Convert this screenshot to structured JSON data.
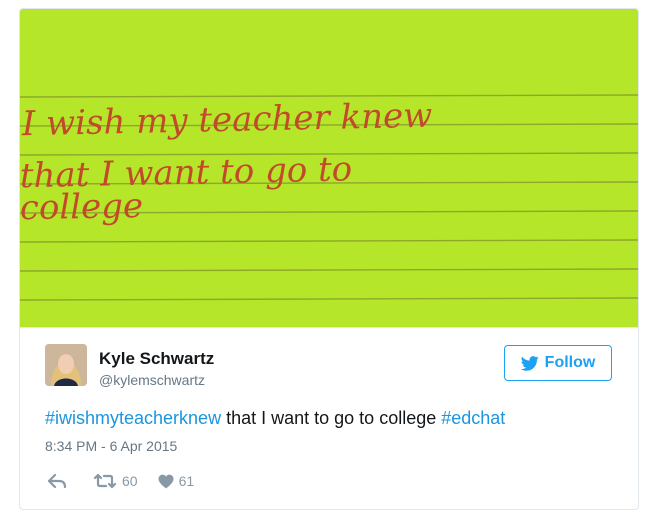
{
  "photo": {
    "handwriting_lines": [
      "I wish my teacher knew",
      "that I want to go to",
      "college"
    ]
  },
  "user": {
    "name": "Kyle Schwartz",
    "handle": "@kylemschwartz"
  },
  "follow_label": "Follow",
  "tweet": {
    "hashtag1": "#iwishmyteacherknew",
    "text": "that I want to go to college",
    "hashtag2": "#edchat",
    "timestamp": "8:34 PM - 6 Apr 2015"
  },
  "actions": {
    "retweet_count": "60",
    "like_count": "61"
  },
  "colors": {
    "paper": "#b6e62a",
    "ink": "#c14a2a",
    "link": "#1b95e0",
    "follow": "#1da1f2"
  }
}
